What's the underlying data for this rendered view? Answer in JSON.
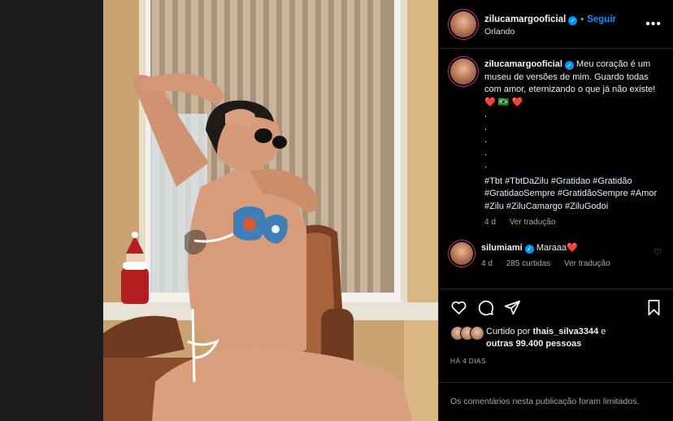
{
  "header": {
    "username": "zilucamargooficial",
    "verified": true,
    "follow_label": "Seguir",
    "location": "Orlando",
    "more_icon": "more-horizontal-icon"
  },
  "caption": {
    "username": "zilucamargooficial",
    "text": "Meu coração é um museu de versões de mim. Guardo todas com amor, eternizando o que já não existe! ❤️ 🇧🇷 ❤️\n.\n.\n.\n.\n.",
    "hashtags": "#Tbt #TbtDaZilu #Gratidao #Gratidão #GratidaoSempre #GratidãoSempre #Amor #Zilu #ZiluCamargo #ZiluGodoi",
    "age": "4 d",
    "translate_label": "Ver tradução"
  },
  "comment": {
    "username": "silumiami",
    "text": "Maraaa❤️",
    "age": "4 d",
    "likes": "285 curtidas",
    "translate_label": "Ver tradução"
  },
  "actions": {
    "icons": [
      "heart-icon",
      "comment-icon",
      "share-icon",
      "bookmark-icon"
    ]
  },
  "likes": {
    "prefix": "Curtido por",
    "user": "thais_silva3344",
    "middle": "e",
    "others": "outras 99.400 pessoas"
  },
  "date": "HÁ 4 DIAS",
  "footer": "Os comentários nesta publicação foram limitados.",
  "colors": {
    "background": "#000000",
    "accent_blue": "#0095f6",
    "muted_text": "#a8a8a8",
    "heart_red": "#ff3040"
  }
}
